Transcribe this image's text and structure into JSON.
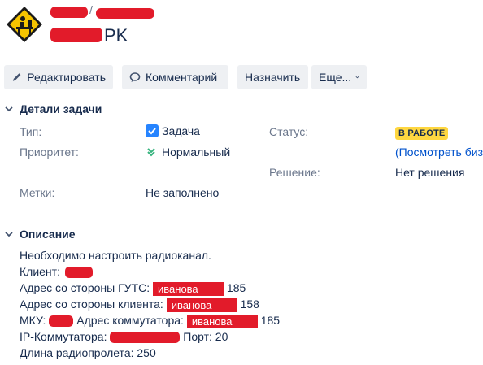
{
  "header": {
    "breadcrumb_separator": "/",
    "issue_title_suffix": "PK"
  },
  "toolbar": {
    "edit_label": "Редактировать",
    "comment_label": "Комментарий",
    "assign_label": "Назначить",
    "more_label": "Еще..."
  },
  "details": {
    "section_title": "Детали задачи",
    "type_label": "Тип:",
    "type_value": "Задача",
    "status_label": "Статус:",
    "status_value": "В РАБОТЕ",
    "status_link": "(Посмотреть биз",
    "priority_label": "Приоритет:",
    "priority_value": "Нормальный",
    "resolution_label": "Решение:",
    "resolution_value": "Нет решения",
    "labels_label": "Метки:",
    "labels_value": "Не заполнено",
    "colors": {
      "status_bg": "#ffd740",
      "checkbox": "#2684ff",
      "priority": "#36b37e"
    }
  },
  "description": {
    "section_title": "Описание",
    "line1": "Необходимо настроить радиоканал.",
    "client_label": "Клиент:",
    "gts_label": "Адрес со стороны ГУТС:",
    "gts_redacted": "иванова",
    "gts_number": "185",
    "client_addr_label": "Адрес со стороны клиента:",
    "client_addr_redacted": "иванова",
    "client_addr_number": "158",
    "mku_label": "МКУ:",
    "switch_addr_label": "Адрес коммутатора:",
    "switch_redacted": "иванова",
    "switch_number": "185",
    "ip_label": "IP-Коммутатора:",
    "port_label": "Порт: 20",
    "radio_length": "Длина радиопролета: 250"
  }
}
